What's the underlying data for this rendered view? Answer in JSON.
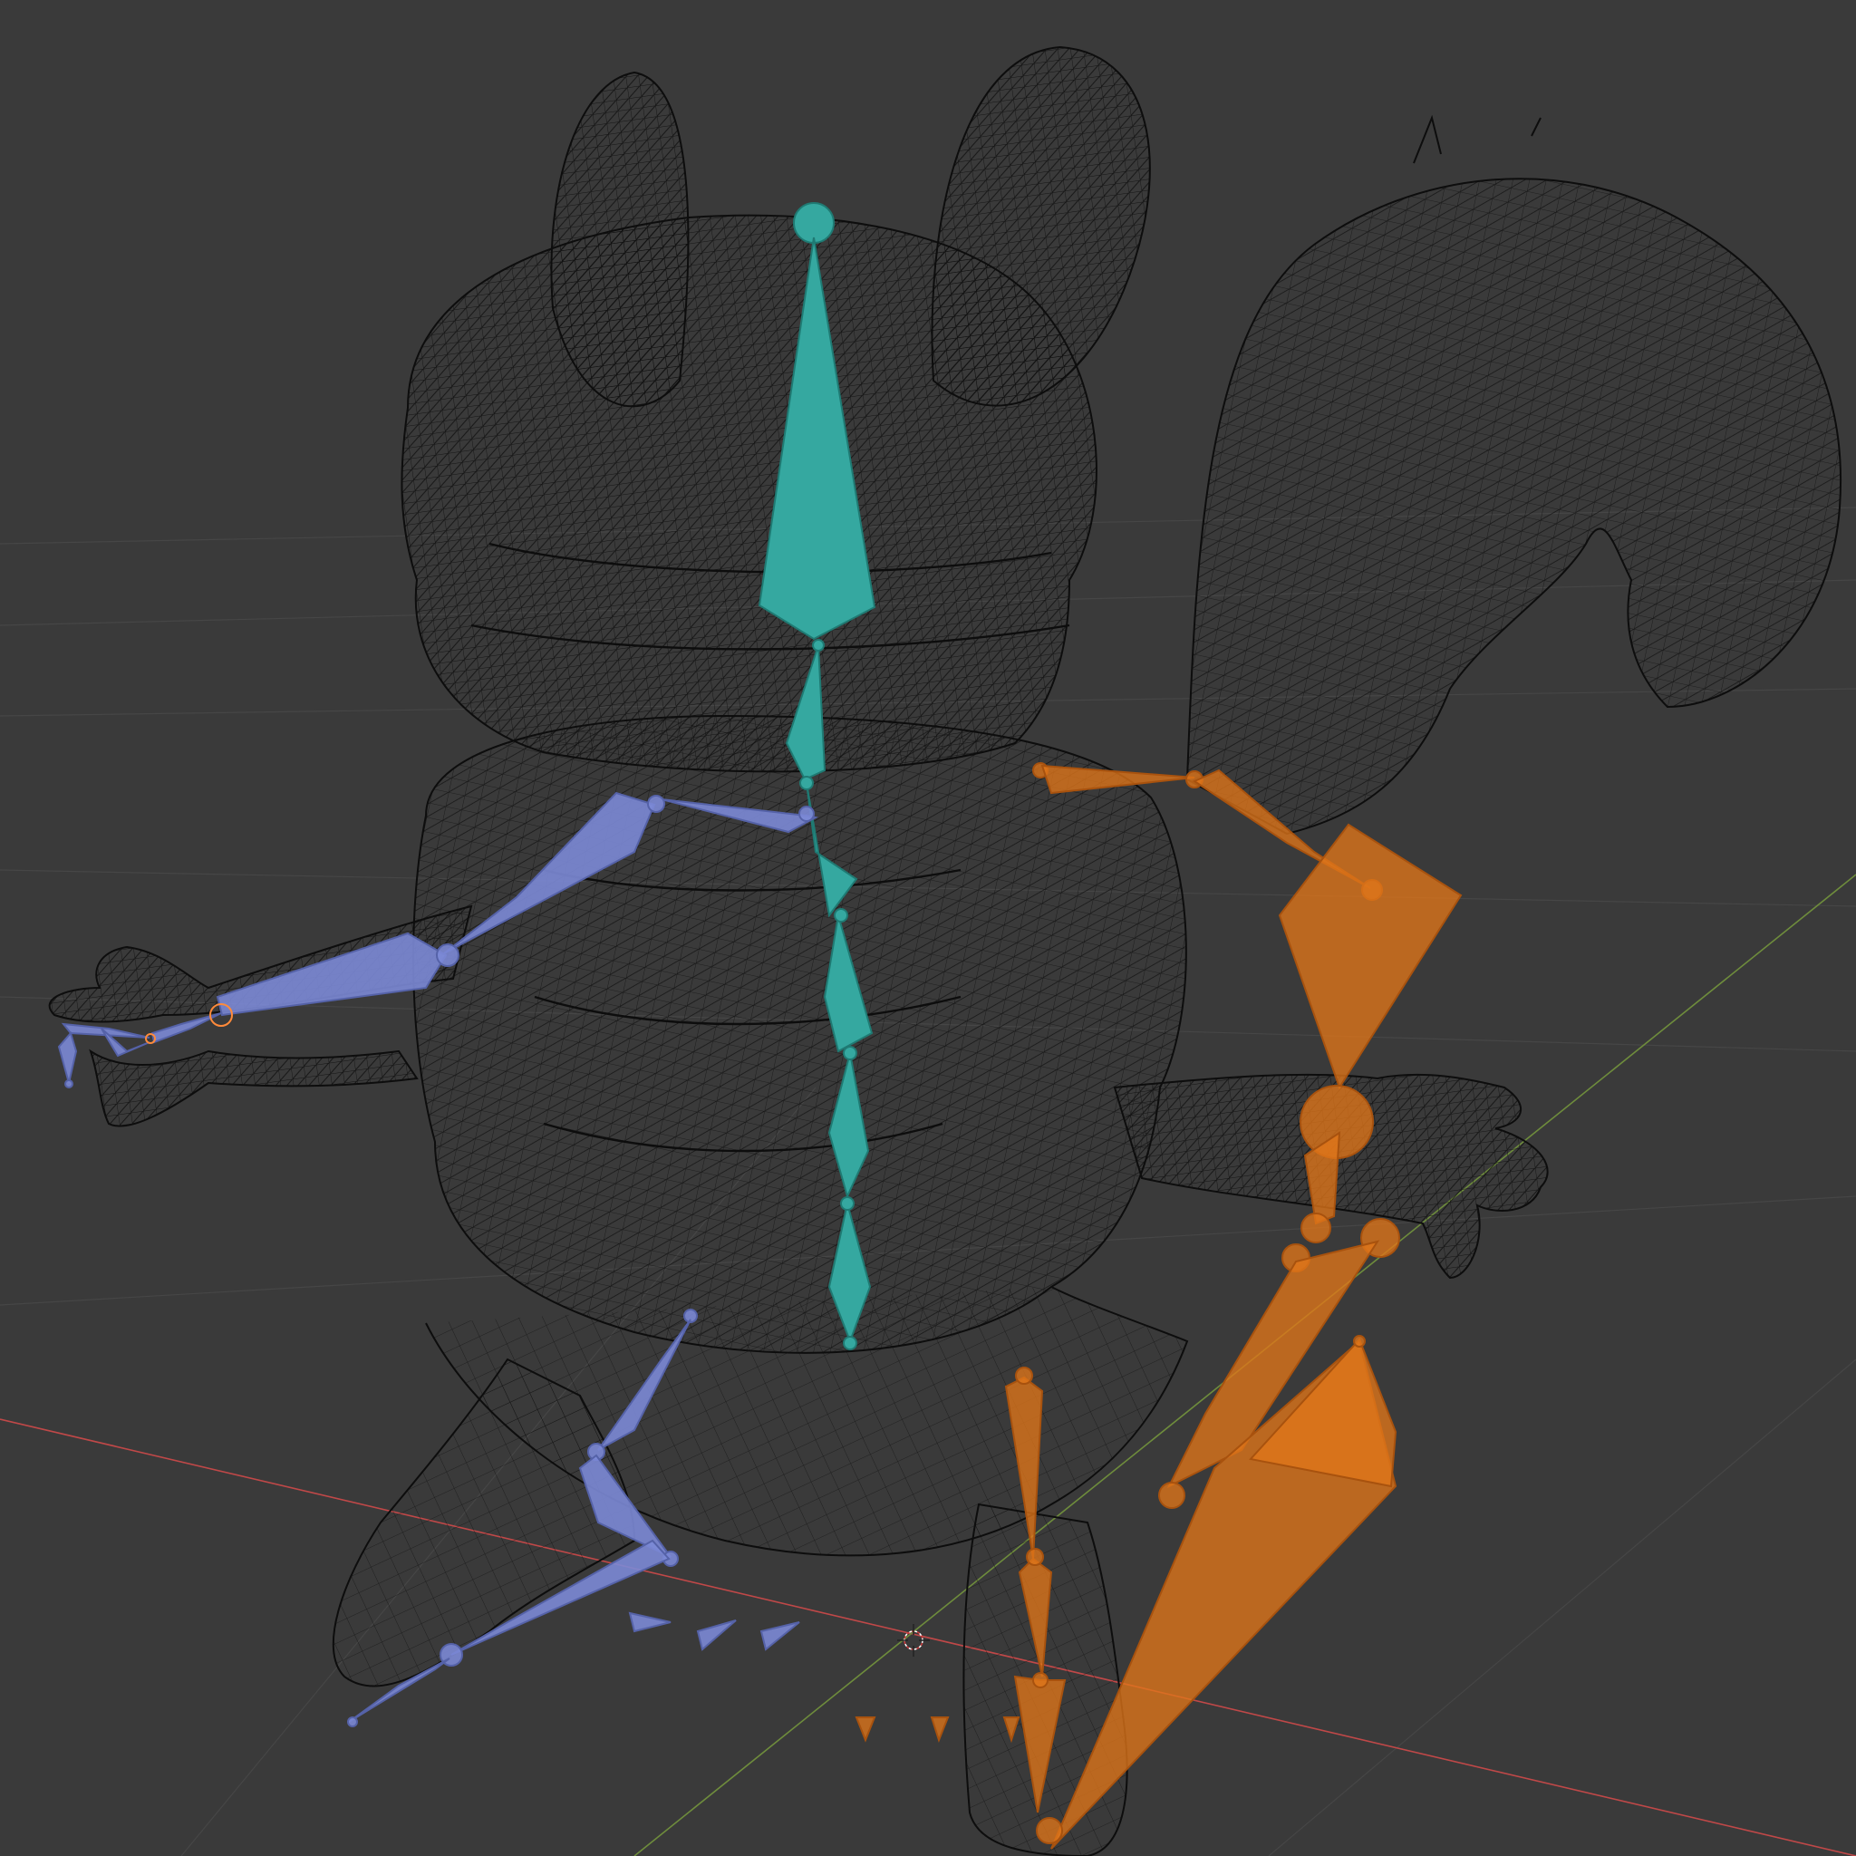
{
  "viewport": {
    "background": "#3a3a3a",
    "mode": "wireframe",
    "object": "squirrel-character-mesh",
    "armature": "armature-rig"
  },
  "colors": {
    "mesh_wire": "#0d0d0d",
    "grid_line": "#4a4a4a",
    "axis_x": "#c04848",
    "axis_y": "#6e8c3c",
    "bone_center": "#35a8a0",
    "bone_center_dark": "#1f7a73",
    "bone_left": "#7c8ad6",
    "bone_left_dark": "#5562a8",
    "bone_right": "#e0761a",
    "bone_right_dark": "#a8520e",
    "selection_outline": "#ff8a3a"
  },
  "bone_groups": [
    {
      "name": "spine-chain",
      "color": "bone_center"
    },
    {
      "name": "left-limbs",
      "color": "bone_left"
    },
    {
      "name": "right-limbs",
      "color": "bone_right"
    }
  ],
  "icons": [
    "3d-cursor-icon"
  ]
}
